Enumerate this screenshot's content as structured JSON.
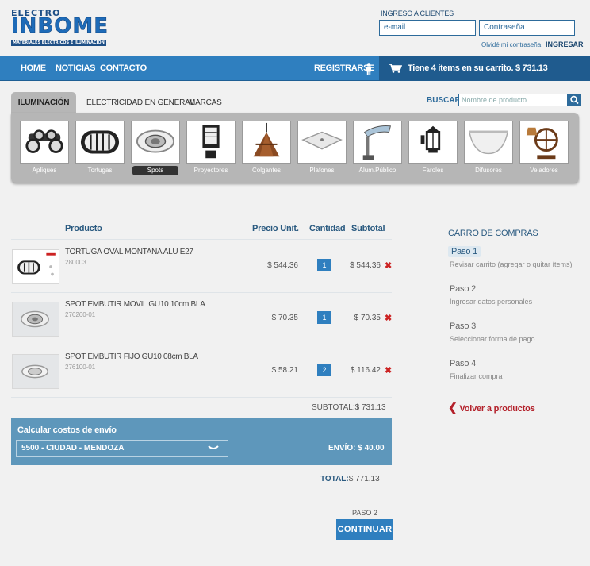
{
  "logo": {
    "line1": "ELECTRO",
    "line2": "INBOME",
    "line3": "MATERIALES ELECTRICOS E ILUMINACION"
  },
  "login": {
    "label": "INGRESO A CLIENTES",
    "email_placeholder": "e-mail",
    "password_placeholder": "Contraseña",
    "forgot": "Olvidé mi contraseña",
    "submit": "INGRESAR"
  },
  "nav": {
    "home": "HOME",
    "noticias": "NOTICIAS",
    "contacto": "CONTACTO",
    "registrarse": "REGISTRARSE",
    "cart_text": "Tiene 4 items en su carrito.  $ 731.13"
  },
  "tabs": {
    "iluminacion": "ILUMINACIÓN",
    "electricidad": "ELECTRICIDAD EN GENERAL",
    "marcas": "MARCAS"
  },
  "search": {
    "label": "BUSCAR",
    "placeholder": "Nombre de producto"
  },
  "categories": [
    {
      "label": "Apliques",
      "icon": "spotlight-cluster-icon"
    },
    {
      "label": "Tortugas",
      "icon": "oval-turtle-light-icon"
    },
    {
      "label": "Spots",
      "icon": "recessed-spot-icon",
      "active": true
    },
    {
      "label": "Proyectores",
      "icon": "floodlight-icon"
    },
    {
      "label": "Colgantes",
      "icon": "pendant-lamp-icon"
    },
    {
      "label": "Plafones",
      "icon": "ceiling-plafon-icon"
    },
    {
      "label": "Alum.Público",
      "icon": "street-light-icon"
    },
    {
      "label": "Faroles",
      "icon": "lantern-icon"
    },
    {
      "label": "Difusores",
      "icon": "diffuser-icon"
    },
    {
      "label": "Veladores",
      "icon": "table-lamp-icon"
    }
  ],
  "table": {
    "headers": {
      "producto": "Producto",
      "precio": "Precio Unit.",
      "cantidad": "Cantidad",
      "subtotal": "Subtotal"
    },
    "rows": [
      {
        "name": "TORTUGA OVAL MONTANA ALU E27",
        "code": "280003",
        "price": "$ 544.36",
        "qty": "1",
        "subtotal": "$ 544.36"
      },
      {
        "name": "SPOT EMBUTIR MOVIL GU10 10cm BLA",
        "code": "276260-01",
        "price": "$ 70.35",
        "qty": "1",
        "subtotal": "$ 70.35"
      },
      {
        "name": "SPOT EMBUTIR FIJO GU10 08cm BLA",
        "code": "276100-01",
        "price": "$ 58.21",
        "qty": "2",
        "subtotal": "$ 116.42"
      }
    ],
    "delete_glyph": "✖",
    "subtotal_line": "SUBTOTAL:$ 731.13"
  },
  "shipping": {
    "title": "Calcular costos de envío",
    "selected": "5500 - CIUDAD - MENDOZA",
    "envio": "ENVÍO: $ 40.00"
  },
  "total": {
    "label": "TOTAL:",
    "value": "$ 771.13"
  },
  "checkout": {
    "paso": "PASO 2",
    "continuar": "CONTINUAR"
  },
  "sidebar": {
    "title": "CARRO DE COMPRAS",
    "steps": [
      {
        "title": "Paso 1",
        "desc": "Revisar carrito (agregar o quitar ítems)"
      },
      {
        "title": "Paso 2",
        "desc": "Ingresar datos personales"
      },
      {
        "title": "Paso 3",
        "desc": "Seleccionar forma de pago"
      },
      {
        "title": "Paso 4",
        "desc": "Finalizar compra"
      }
    ],
    "volver": "Volver a productos"
  },
  "colors": {
    "brand_blue": "#2f7fbf",
    "dark_blue": "#1f5b8e",
    "shipping_blue": "#5e97bb",
    "delete_red": "#cc2222",
    "volver_red": "#b3202a"
  }
}
